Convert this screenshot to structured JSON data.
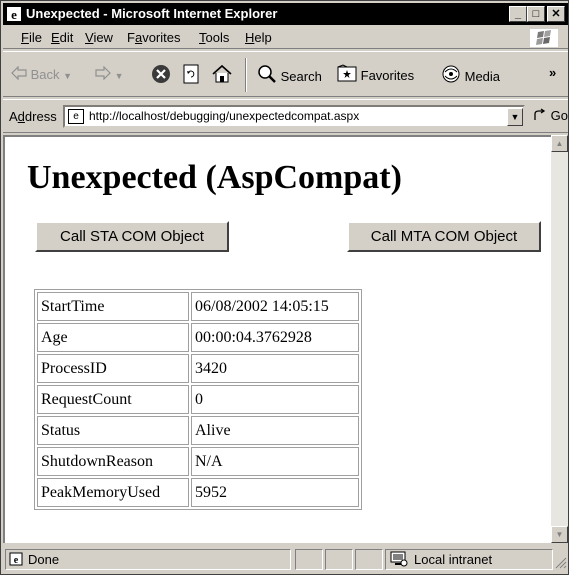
{
  "window": {
    "title": "Unexpected - Microsoft Internet Explorer",
    "buttons": {
      "minimize": "_",
      "maximize": "□",
      "close": "✕"
    }
  },
  "menu": [
    {
      "key": "F",
      "rest": "ile"
    },
    {
      "key": "E",
      "rest": "dit"
    },
    {
      "key": "V",
      "rest": "iew"
    },
    {
      "pre": "F",
      "key": "a",
      "rest": "vorites"
    },
    {
      "key": "T",
      "rest": "ools"
    },
    {
      "key": "H",
      "rest": "elp"
    }
  ],
  "toolbar": {
    "back_label": "Back",
    "search_label": "Search",
    "favorites_label": "Favorites",
    "media_label": "Media",
    "more_glyph": "»"
  },
  "address": {
    "label_pre": "A",
    "label_key": "d",
    "label_rest": "dress",
    "url": "http://localhost/debugging/unexpectedcompat.aspx",
    "go_label": "Go"
  },
  "page": {
    "heading": "Unexpected (AspCompat)",
    "sta_button": "Call STA COM Object",
    "mta_button": "Call MTA COM Object",
    "table": [
      {
        "key": "StartTime",
        "value": "06/08/2002 14:05:15"
      },
      {
        "key": "Age",
        "value": "00:00:04.3762928"
      },
      {
        "key": "ProcessID",
        "value": "3420"
      },
      {
        "key": "RequestCount",
        "value": "0"
      },
      {
        "key": "Status",
        "value": "Alive"
      },
      {
        "key": "ShutdownReason",
        "value": "N/A"
      },
      {
        "key": "PeakMemoryUsed",
        "value": "5952"
      }
    ]
  },
  "status": {
    "text": "Done",
    "zone": "Local intranet"
  }
}
